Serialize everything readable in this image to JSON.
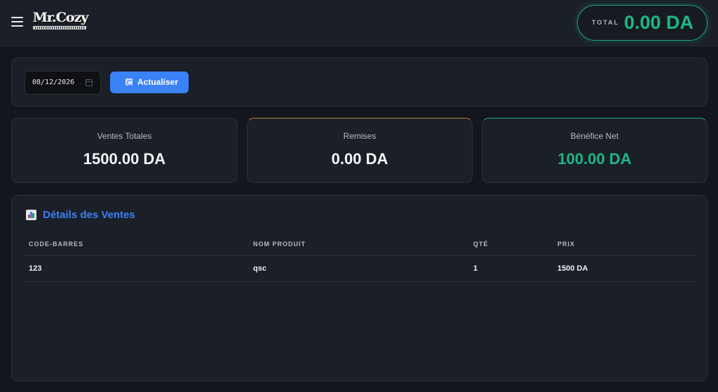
{
  "header": {
    "logo_text": "Mr.Cozy",
    "total_label": "TOTAL",
    "total_value": "0.00 DA"
  },
  "filter": {
    "date_value": "08/12/2026",
    "refresh_label": "Actualiser"
  },
  "stats": [
    {
      "label": "Ventes Totales",
      "value": "1500.00 DA"
    },
    {
      "label": "Remises",
      "value": "0.00 DA"
    },
    {
      "label": "Bénéfice Net",
      "value": "100.00 DA"
    }
  ],
  "details": {
    "title": "Détails des Ventes",
    "columns": [
      "CODE-BARRES",
      "NOM PRODUIT",
      "QTÉ",
      "PRIX"
    ],
    "rows": [
      [
        "123",
        "qsc",
        "1",
        "1500 DA"
      ]
    ]
  },
  "colors": {
    "accent_blue": "#3b82f6",
    "accent_green": "#1fb784",
    "accent_amber": "#b8862b",
    "background": "#13161c",
    "panel": "#1b1f27"
  },
  "icons": {
    "menu": "hamburger-menu-icon",
    "calendar": "calendar-icon",
    "refresh": "refresh-icon",
    "details": "bar-chart-icon"
  }
}
